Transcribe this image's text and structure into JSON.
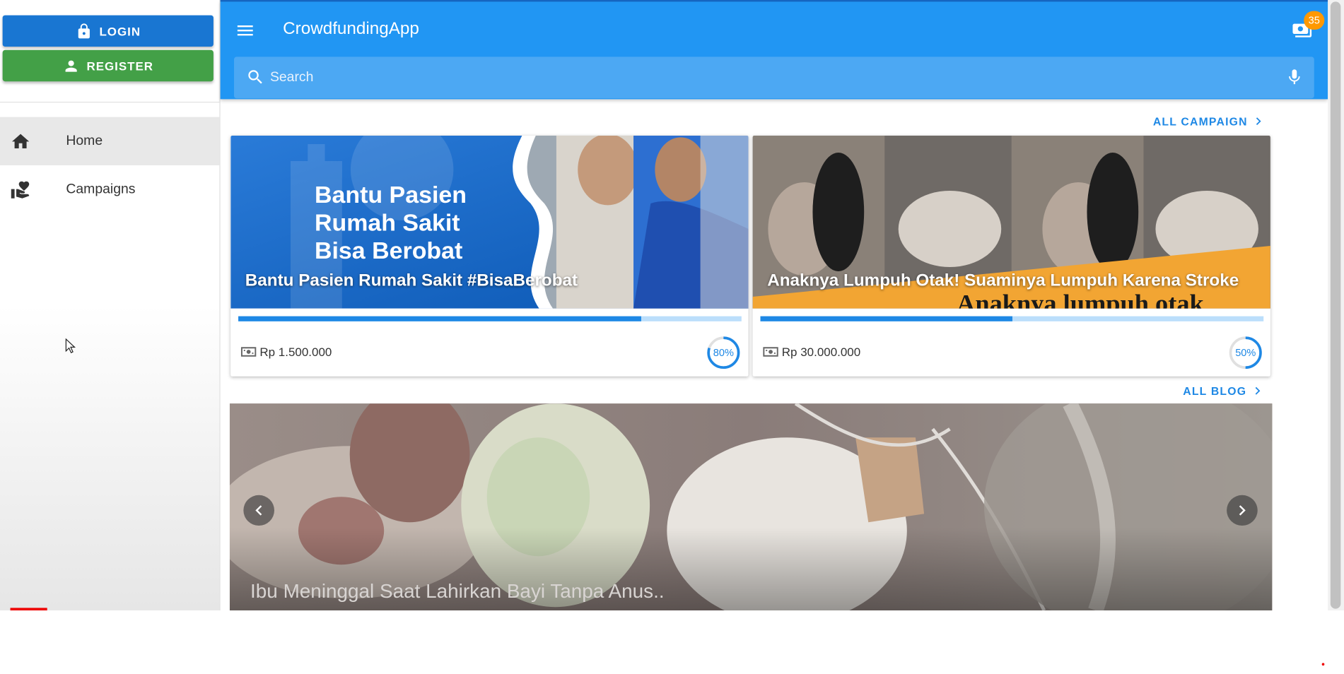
{
  "auth": {
    "login_label": "LOGIN",
    "register_label": "REGISTER"
  },
  "nav": {
    "items": [
      {
        "label": "Home",
        "icon": "home-icon",
        "active": true
      },
      {
        "label": "Campaigns",
        "icon": "volunteer-hand-heart-icon",
        "active": false
      }
    ]
  },
  "topbar": {
    "title": "CrowdfundingApp",
    "cart_badge": "35",
    "search_placeholder": "Search",
    "color": "#2196f3"
  },
  "campaigns": {
    "section_link": "ALL CAMPAIGN",
    "items": [
      {
        "image_text": [
          "Bantu Pasien",
          "Rumah Sakit",
          "Bisa Berobat"
        ],
        "title": "Bantu Pasien Rumah Sakit #BisaBerobat",
        "amount": "Rp 1.500.000",
        "progress": 0.8,
        "percent_label": "80%"
      },
      {
        "image_text": [
          "Anaknya lumpuh otak"
        ],
        "title": "Anaknya Lumpuh Otak! Suaminya Lumpuh Karena Stroke",
        "amount": "Rp 30.000.000",
        "progress": 0.5,
        "percent_label": "50%"
      }
    ]
  },
  "blog": {
    "section_link": "ALL BLOG",
    "slide_title": "Ibu Meninggal Saat Lahirkan Bayi Tanpa Anus.."
  }
}
